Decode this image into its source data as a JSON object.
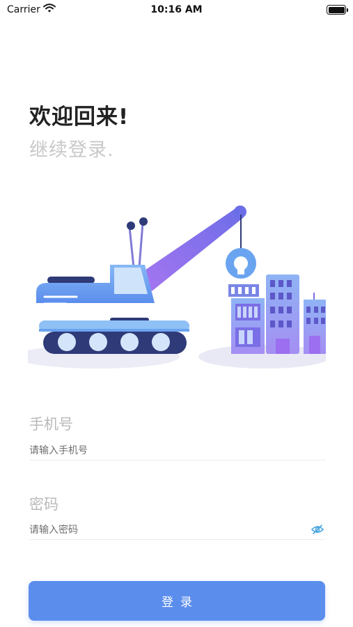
{
  "status_bar": {
    "carrier": "Carrier",
    "time": "10:16 AM",
    "battery_level": 1.0
  },
  "header": {
    "title": "欢迎回来!",
    "subtitle": "继续登录."
  },
  "illustration": {
    "subject": "crane-and-buildings",
    "colors": {
      "primary_blue": "#6aa4f0",
      "purple": "#8c6cf2",
      "navy": "#2f3a78",
      "ground": "#ececf6"
    }
  },
  "form": {
    "phone": {
      "label": "手机号",
      "placeholder": "请输入手机号",
      "value": ""
    },
    "password": {
      "label": "密码",
      "placeholder": "请输入密码",
      "value": "",
      "toggle_icon": "eye-icon"
    }
  },
  "login_button": {
    "label": "登录",
    "color": "#5b8ded"
  }
}
